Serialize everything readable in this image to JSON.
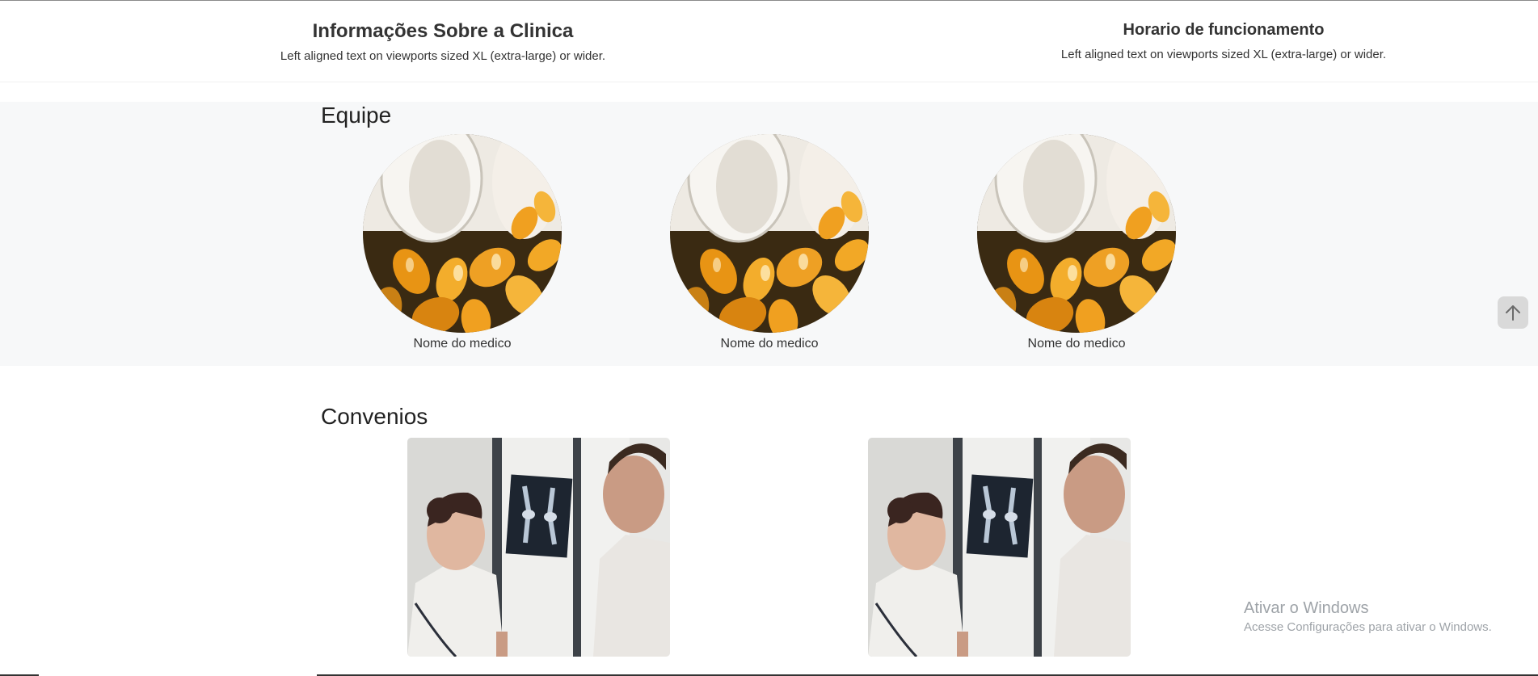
{
  "info": {
    "left": {
      "title": "Informações Sobre a Clinica",
      "text": "Left aligned text on viewports sized XL (extra-large) or wider."
    },
    "right": {
      "title": "Horario de funcionamento",
      "text": "Left aligned text on viewports sized XL (extra-large) or wider."
    }
  },
  "team": {
    "title": "Equipe",
    "members": [
      {
        "name": "Nome do medico",
        "photo_icon": "capsules-photo"
      },
      {
        "name": "Nome do medico",
        "photo_icon": "capsules-photo"
      },
      {
        "name": "Nome do medico",
        "photo_icon": "capsules-photo"
      }
    ]
  },
  "agreements": {
    "title": "Convenios",
    "items": [
      {
        "photo_icon": "doctors-xray-photo"
      },
      {
        "photo_icon": "doctors-xray-photo"
      }
    ]
  },
  "scroll_top": {
    "icon": "arrow-up-icon"
  },
  "watermark": {
    "title": "Ativar o Windows",
    "subtitle": "Acesse Configurações para ativar o Windows."
  },
  "colors": {
    "team_bg": "#f7f8f9",
    "capsule_amber": "#f0a020",
    "coat_white": "#e9e6e2"
  }
}
